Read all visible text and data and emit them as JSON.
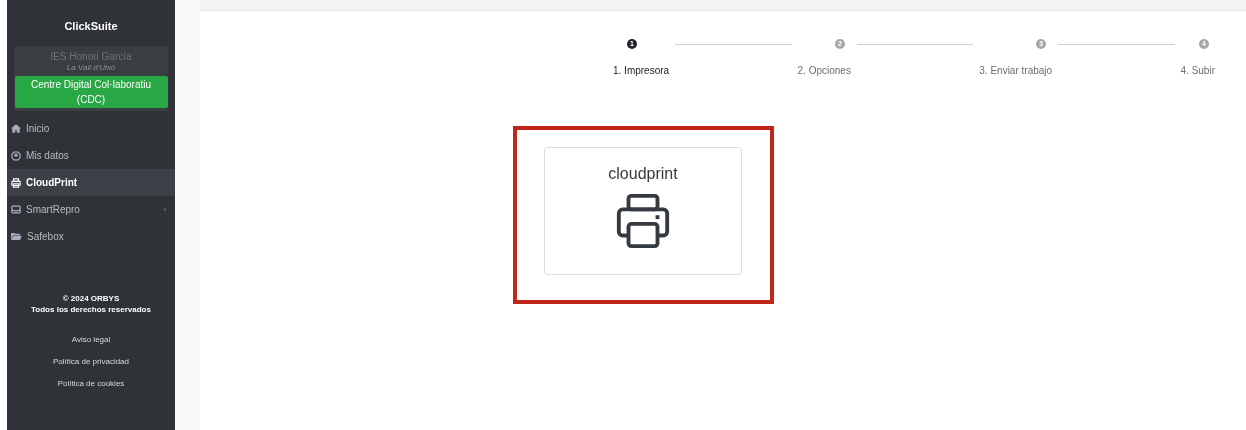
{
  "sidebar": {
    "app_name": "ClickSuite",
    "school": "IES Honori García",
    "town": "La Vall d'Uixó",
    "center_button": "Centre Digital Col·laboratiu (CDC)",
    "items": [
      {
        "label": "Inicio",
        "selected": false,
        "has_submenu": false
      },
      {
        "label": "Mis datos",
        "selected": false,
        "has_submenu": false
      },
      {
        "label": "CloudPrint",
        "selected": true,
        "has_submenu": false
      },
      {
        "label": "SmartRepro",
        "selected": false,
        "has_submenu": true
      },
      {
        "label": "Safebox",
        "selected": false,
        "has_submenu": false
      }
    ],
    "copyright": "© 2024 ORBYS",
    "rights": "Todos los derechos reservados",
    "links": [
      "Aviso legal",
      "Política de privacidad",
      "Política de cookies"
    ]
  },
  "stepper": [
    {
      "number": "1",
      "label": "1. Impresora",
      "selected": true
    },
    {
      "number": "2",
      "label": "2. Opciones",
      "selected": false
    },
    {
      "number": "3",
      "label": "3. Enviar trabajo",
      "selected": false
    },
    {
      "number": "4",
      "label": "4. Subir",
      "selected": false
    }
  ],
  "printers": [
    {
      "name": "cloudprint",
      "highlighted": true
    }
  ]
}
